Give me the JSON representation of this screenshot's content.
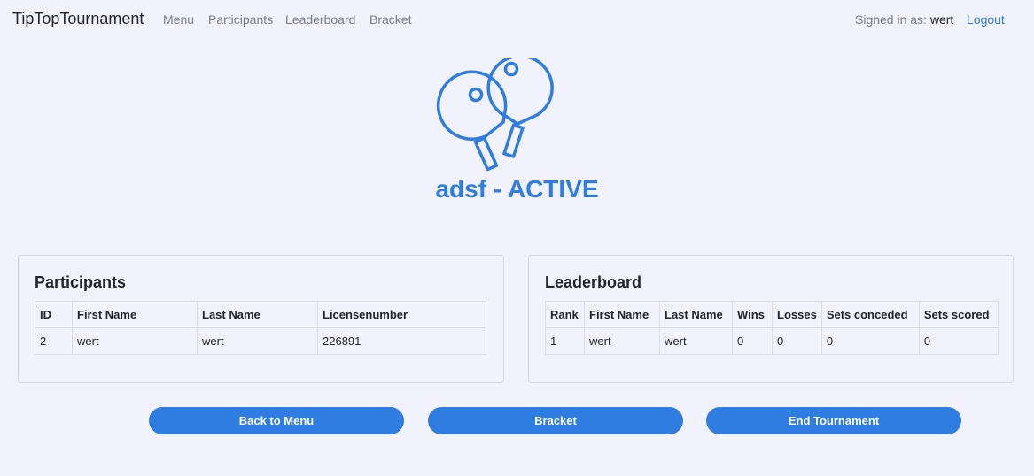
{
  "nav": {
    "brand": "TipTopTournament",
    "links": [
      "Menu",
      "Participants",
      "Leaderboard",
      "Bracket"
    ],
    "signed_label": "Signed in as:",
    "username": "wert",
    "logout": "Logout"
  },
  "tournament": {
    "title": "adsf - ACTIVE",
    "logo_icon": "ping-pong-paddles-icon",
    "accent_color": "#2f7de1"
  },
  "participants": {
    "title": "Participants",
    "headers": [
      "ID",
      "First Name",
      "Last Name",
      "Licensenumber"
    ],
    "rows": [
      [
        "2",
        "wert",
        "wert",
        "226891"
      ]
    ]
  },
  "leaderboard": {
    "title": "Leaderboard",
    "headers": [
      "Rank",
      "First Name",
      "Last Name",
      "Wins",
      "Losses",
      "Sets conceded",
      "Sets scored"
    ],
    "rows": [
      [
        "1",
        "wert",
        "wert",
        "0",
        "0",
        "0",
        "0"
      ]
    ]
  },
  "buttons": {
    "back": "Back to Menu",
    "bracket": "Bracket",
    "end": "End Tournament"
  }
}
